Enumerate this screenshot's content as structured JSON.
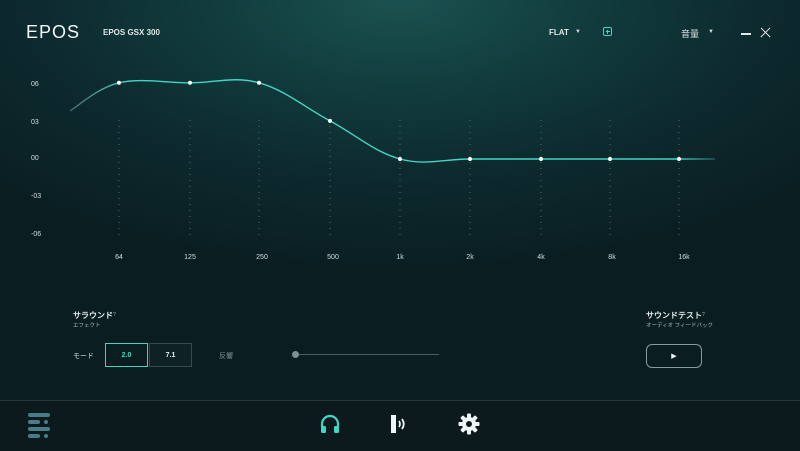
{
  "header": {
    "logo": "EPOS",
    "device": "EPOS GSX 300",
    "preset": "FLAT",
    "volume_label": "音量"
  },
  "eq": {
    "y_labels": [
      "06",
      "03",
      "00",
      "-03",
      "-06"
    ],
    "bands": [
      {
        "label": "64",
        "gain": 6
      },
      {
        "label": "125",
        "gain": 6
      },
      {
        "label": "250",
        "gain": 6
      },
      {
        "label": "500",
        "gain": 3
      },
      {
        "label": "1k",
        "gain": 0
      },
      {
        "label": "2k",
        "gain": 0
      },
      {
        "label": "4k",
        "gain": 0
      },
      {
        "label": "8k",
        "gain": 0
      },
      {
        "label": "16k",
        "gain": 0
      }
    ],
    "curve_color": "#3fd6c3"
  },
  "surround": {
    "title": "サラウンド",
    "help": "?",
    "subtitle": "エフェクト",
    "mode_label": "モード",
    "modes": [
      "2.0",
      "7.1"
    ],
    "selected_mode": "2.0",
    "reverb_label": "反響"
  },
  "sound_test": {
    "title": "サウンドテスト",
    "help": "?",
    "subtitle": "オーディオ フィードバック",
    "play_symbol": "▶"
  },
  "footer": {
    "active_tab": "headphones",
    "icons": [
      "menu-icon",
      "headphones-icon",
      "microphone-icon",
      "gear-icon"
    ]
  },
  "colors": {
    "accent": "#3fd6c3",
    "background": "#0d2a2e"
  }
}
